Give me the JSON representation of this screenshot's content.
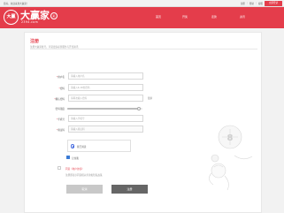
{
  "topbar": {
    "welcome": "您好，欢迎来到大赢家！",
    "links": [
      "注册",
      "帮助",
      "客服"
    ],
    "login_label": "立即登录"
  },
  "header": {
    "logo_mark": "大赢",
    "logo_name": "大赢家",
    "logo_domain": "2394.com",
    "logo_badge": "彩",
    "nav": [
      "首页",
      "开奖",
      "走势",
      "资讯"
    ]
  },
  "form": {
    "title": "注册",
    "subtitle": "注册大赢家账号，享受更多彩票服务与开奖资讯",
    "fields": [
      {
        "label": "用户名",
        "required": true,
        "placeholder": "请输入用户名"
      },
      {
        "label": "密码",
        "required": true,
        "placeholder": "请输入6-16位密码"
      },
      {
        "label": "确认密码",
        "required": true,
        "placeholder": "请再次输入密码"
      },
      {
        "label": "密码强度",
        "required": false,
        "placeholder": ""
      },
      {
        "label": "手机号",
        "required": true,
        "placeholder": "请输入手机号"
      },
      {
        "label": "验证码",
        "required": true,
        "placeholder": "请输入验证码"
      }
    ],
    "eye_toggle": "显示",
    "radio_option": "我已阅读",
    "checkbox_label": "记住我",
    "agree_text": "同意《用户协议》",
    "agree_note": "注册即表示同意相关条款和隐私政策",
    "btn_cancel": "取消",
    "btn_submit": "注册",
    "password_strength": 0.95,
    "colors": {
      "brand": "#e43d4b",
      "link": "#3a7bd5"
    }
  }
}
